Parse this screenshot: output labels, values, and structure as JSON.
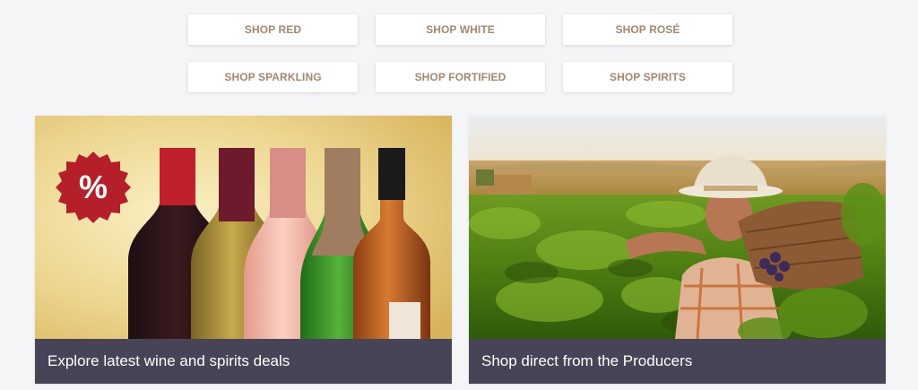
{
  "shop_buttons": [
    {
      "label": "SHOP RED"
    },
    {
      "label": "SHOP WHITE"
    },
    {
      "label": "SHOP ROSÉ"
    },
    {
      "label": "SHOP SPARKLING"
    },
    {
      "label": "SHOP FORTIFIED"
    },
    {
      "label": "SHOP SPIRITS"
    }
  ],
  "promo_cards": [
    {
      "caption": "Explore latest wine and spirits deals",
      "badge_symbol": "%",
      "image": "wine-bottles-deals"
    },
    {
      "caption": "Shop direct from the Producers",
      "image": "vineyard-farmer"
    }
  ],
  "colors": {
    "button_text": "#a5876f",
    "caption_bg": "#464456",
    "badge": "#b41f2a",
    "page_bg": "#f4f5f7"
  }
}
